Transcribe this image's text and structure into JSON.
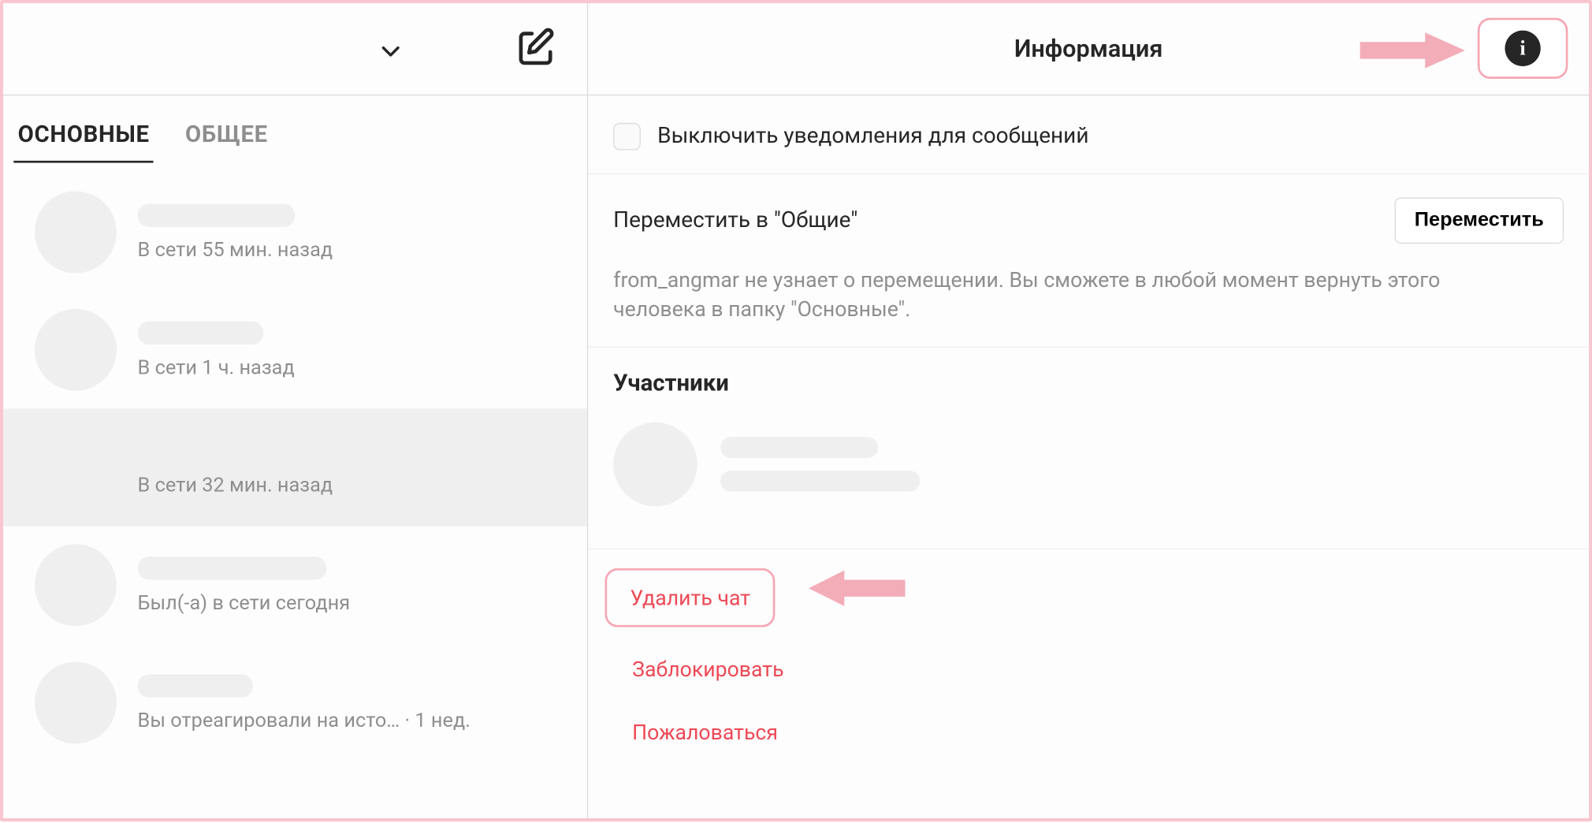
{
  "sidebar": {
    "tabs": {
      "primary": "ОСНОВНЫЕ",
      "general": "ОБЩЕЕ"
    },
    "chats": [
      {
        "status": "В сети 55 мин. назад"
      },
      {
        "status": "В сети 1 ч. назад"
      },
      {
        "status": "В сети 32 мин. назад"
      },
      {
        "status": "Был(-а) в сети сегодня"
      },
      {
        "status": "Вы отреагировали на исто… · 1 нед."
      }
    ]
  },
  "main": {
    "title": "Информация",
    "mute_label": "Выключить уведомления для сообщений",
    "move": {
      "title": "Переместить в \"Общие\"",
      "button": "Переместить",
      "description": "from_angmar не узнает о перемещении. Вы сможете в любой момент вернуть этого человека в папку \"Основные\"."
    },
    "members_heading": "Участники",
    "danger": {
      "delete_chat": "Удалить чат",
      "block": "Заблокировать",
      "report": "Пожаловаться"
    },
    "info_icon_glyph": "i"
  }
}
